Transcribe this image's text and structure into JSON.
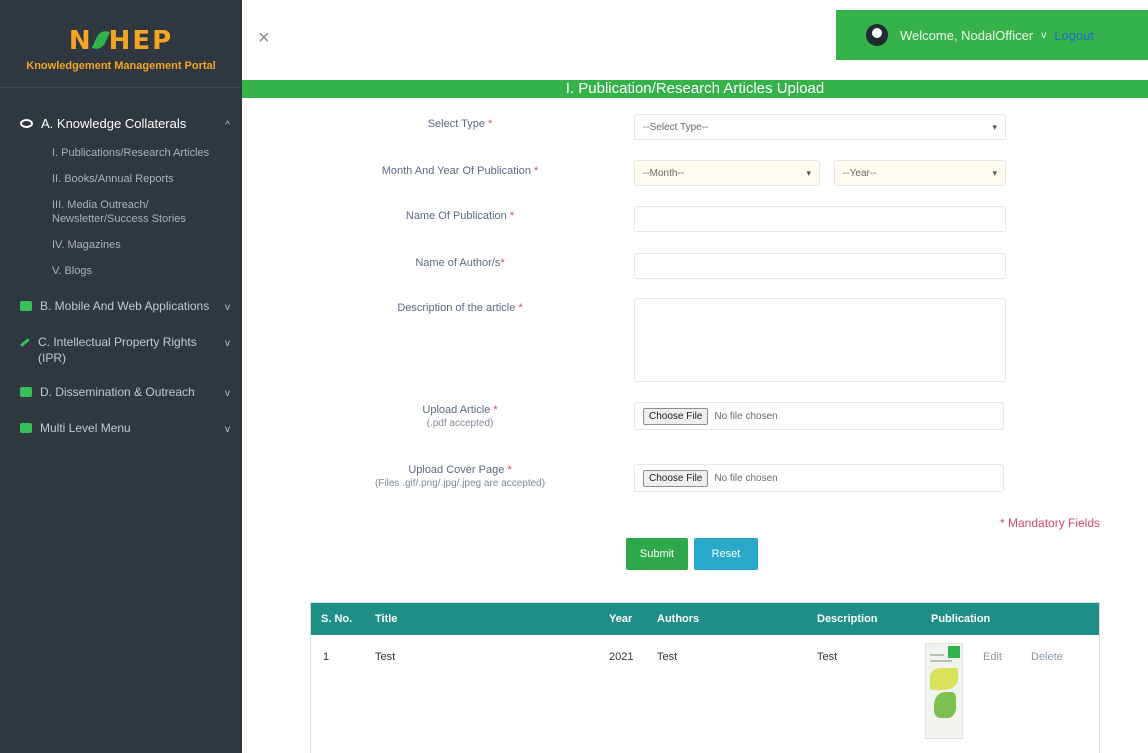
{
  "sidebar": {
    "logo": {
      "left": "N",
      "right": "HEP"
    },
    "portal_name": "Knowledgement Management Portal",
    "groups": [
      {
        "label": "A. Knowledge Collaterals",
        "icon": "eye-icon",
        "open": true,
        "items": [
          {
            "label": "I. Publications/Research Articles"
          },
          {
            "label": "II. Books/Annual Reports"
          },
          {
            "label": "III. Media Outreach/ Newsletter/Success Stories"
          },
          {
            "label": "IV. Magazines"
          },
          {
            "label": "V. Blogs"
          }
        ]
      },
      {
        "label": "B. Mobile And Web Applications",
        "icon": "mobile-icon"
      },
      {
        "label": "C. Intellectual Property Rights (IPR)",
        "icon": "pen-icon"
      },
      {
        "label": "D. Dissemination & Outreach",
        "icon": "chat-icon"
      },
      {
        "label": "Multi Level Menu",
        "icon": "menu-icon"
      }
    ],
    "chevron_open": "^",
    "chevron_closed": "v"
  },
  "header": {
    "close_glyph": "×",
    "welcome_text": "Welcome, NodalOfficer",
    "dropdown_glyph": "v",
    "logout_label": "Logout"
  },
  "page_title": "I. Publication/Research Articles Upload",
  "form": {
    "required_mark": "*",
    "type_label": "Select Type",
    "type_value": "--Select Type--",
    "month_year_label": "Month And Year Of Publication",
    "month_value": "--Month--",
    "year_value": "--Year--",
    "publication_name_label": "Name Of Publication",
    "publication_name_value": "",
    "authors_label": "Name of Author/s",
    "authors_value": "",
    "description_label": "Description of the article",
    "description_value": "",
    "upload_article_label": "Upload Article",
    "upload_article_hint": "(.pdf accepted)",
    "upload_cover_label": "Upload Cover Page",
    "upload_cover_hint": "(Files .gif/.png/.jpg/.jpeg are accepted)",
    "choose_file_label": "Choose File",
    "no_file_text": "No file chosen",
    "mandatory_note": "* Mandatory Fields",
    "submit_label": "Submit",
    "reset_label": "Reset",
    "select_arrow": "▾"
  },
  "table": {
    "columns": [
      "S. No.",
      "Title",
      "Year",
      "Authors",
      "Description",
      "Publication"
    ],
    "rows": [
      {
        "sno": "1",
        "title": "Test",
        "year": "2021",
        "authors": "Test",
        "description": "Test",
        "edit_label": "Edit",
        "delete_label": "Delete"
      }
    ]
  },
  "colors": {
    "sidebar_bg": "#2f3740",
    "brand_orange": "#f4a521",
    "accent_green": "#35b24a",
    "table_header": "#1e8f86",
    "reset_blue": "#28a9c9",
    "required_red": "#d64a6b"
  }
}
